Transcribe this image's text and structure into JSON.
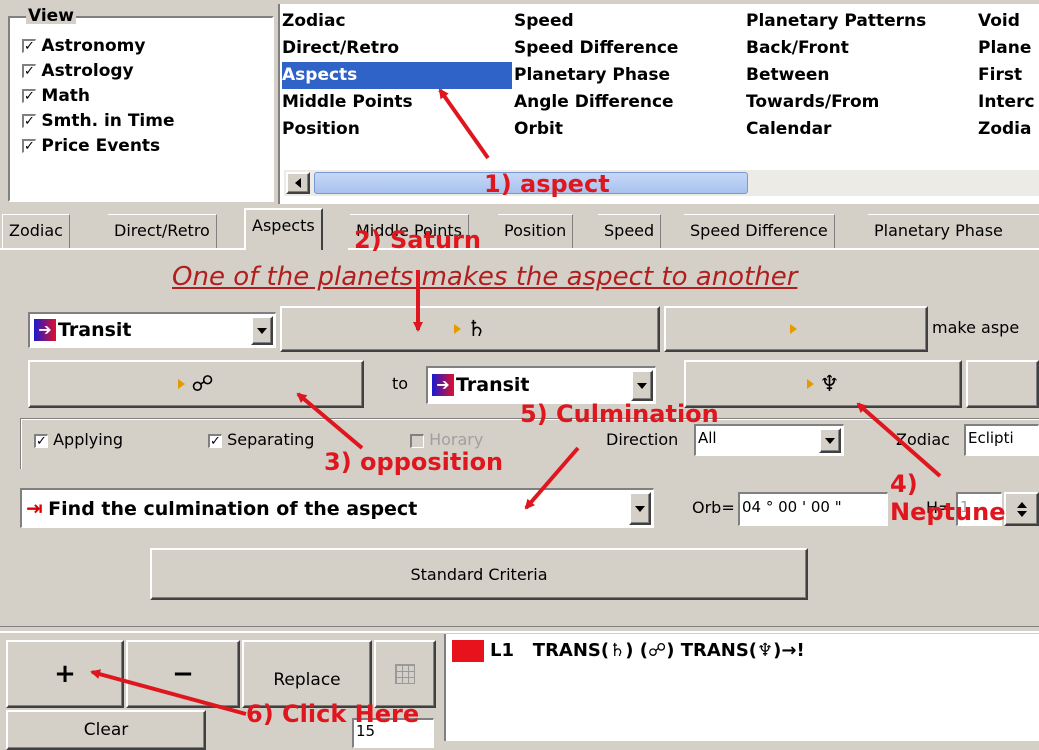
{
  "view_panel": {
    "title": "View",
    "items": [
      "Astronomy",
      "Astrology",
      "Math",
      "Smth. in Time",
      "Price Events"
    ]
  },
  "menu": {
    "col1": [
      "Zodiac",
      "Direct/Retro",
      "Aspects",
      "Middle Points",
      "Position"
    ],
    "col2": [
      "Speed",
      "Speed Difference",
      "Planetary Phase",
      "Angle Difference",
      "Orbit"
    ],
    "col3": [
      "Planetary Patterns",
      "Back/Front",
      "Between",
      "Towards/From",
      "Calendar"
    ],
    "col4": [
      "Void",
      "Plane",
      "First",
      "Interc",
      "Zodia"
    ],
    "selected": "Aspects"
  },
  "tabs": [
    "Zodiac",
    "Direct/Retro",
    "Aspects",
    "Middle Points",
    "Position",
    "Speed",
    "Speed Difference",
    "Planetary Phase"
  ],
  "active_tab": "Aspects",
  "heading": "One of the planets makes  the aspect to another",
  "row1": {
    "transit_select": "Transit",
    "planet1_symbol": "♄",
    "planet2_symbol": "",
    "make_aspect_label": "make aspe"
  },
  "row2": {
    "aspect_symbol": "☍",
    "to_label": "to",
    "transit_select": "Transit",
    "planet_symbol": "♆"
  },
  "options": {
    "applying": "Applying",
    "separating": "Separating",
    "horary": "Horary",
    "direction_label": "Direction",
    "direction_value": "All",
    "zodiac_label": "Zodiac",
    "zodiac_value": "Eclipti"
  },
  "find": {
    "value": "Find the culmination of the aspect",
    "orb_label": "Orb=",
    "orb_value": "04 ° 00 ' 00 \"",
    "h_label": "H=",
    "h_value": "1"
  },
  "standard_criteria": "Standard Criteria",
  "bottom": {
    "plus": "+",
    "minus": "−",
    "replace": "Replace",
    "clear": "Clear",
    "spin_value": "15",
    "result_label": "L1   TRANS(♄) (☍) TRANS(♆)→!"
  },
  "annotations": {
    "a1": "1) aspect",
    "a2": "2) Saturn",
    "a3": "3) opposition",
    "a4": "4) Neptune",
    "a5": "5) Culmination",
    "a6": "6) Click Here"
  },
  "colors": {
    "accent_red": "#e0161e",
    "selection_blue": "#2f63c7"
  }
}
